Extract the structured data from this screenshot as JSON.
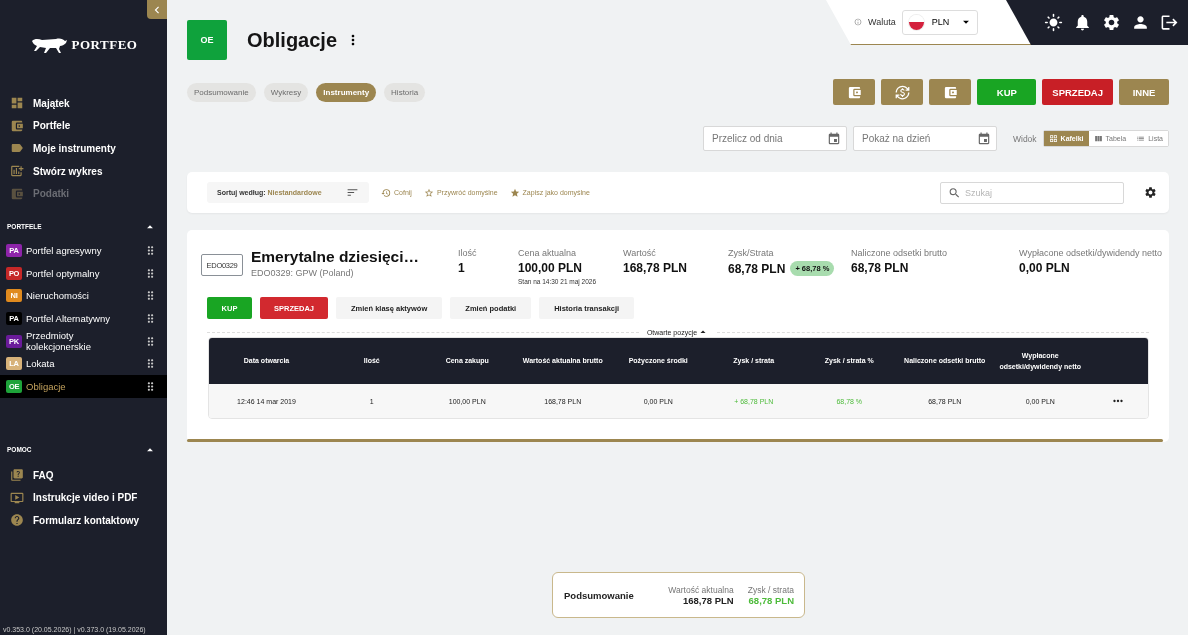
{
  "sidebar": {
    "logo": "PORTFEO",
    "nav": [
      {
        "label": "Majątek",
        "disabled": false
      },
      {
        "label": "Portfele",
        "disabled": false
      },
      {
        "label": "Moje instrumenty",
        "disabled": false
      },
      {
        "label": "Stwórz wykres",
        "disabled": false
      },
      {
        "label": "Podatki",
        "disabled": true
      }
    ],
    "portfolios": {
      "title": "PORTFELE",
      "expanded": true,
      "items": [
        {
          "badge": "PA",
          "label": "Portfel agresywny",
          "color": "#8e24aa",
          "selected": false
        },
        {
          "badge": "PO",
          "label": "Portfel optymalny",
          "color": "#c62828",
          "selected": false
        },
        {
          "badge": "NI",
          "label": "Nieruchomości",
          "color": "#e08a1e",
          "selected": false
        },
        {
          "badge": "PA",
          "label": "Portfel Alternatywny",
          "color": "#000000",
          "selected": false
        },
        {
          "badge": "PK",
          "label": "Przedmioty kolekcjonerskie",
          "color": "#6a1b9a",
          "selected": false
        },
        {
          "badge": "LA",
          "label": "Lokata",
          "color": "#d7b27a",
          "selected": false
        },
        {
          "badge": "OE",
          "label": "Obligacje",
          "color": "#1ea33a",
          "selected": true
        }
      ]
    },
    "help": {
      "title": "POMOC",
      "expanded": true,
      "items": [
        {
          "label": "FAQ"
        },
        {
          "label": "Instrukcje video i PDF"
        },
        {
          "label": "Formularz kontaktowy"
        }
      ]
    },
    "version": "v0.353.0 (20.05.2026) | v0.373.0 (19.05.2026)"
  },
  "header": {
    "currency_label": "Waluta",
    "currency": "PLN"
  },
  "page": {
    "badge": "OE",
    "title": "Obligacje",
    "tabs": [
      {
        "label": "Podsumowanie",
        "selected": false
      },
      {
        "label": "Wykresy",
        "selected": false
      },
      {
        "label": "Instrumenty",
        "selected": true
      },
      {
        "label": "Historia",
        "selected": false
      }
    ],
    "actions": [
      {
        "kind": "buy",
        "label": "KUP"
      },
      {
        "kind": "sell",
        "label": "SPRZEDAJ"
      },
      {
        "kind": "other",
        "label": "INNE"
      }
    ],
    "date_fields": [
      {
        "placeholder": "Przelicz od dnia"
      },
      {
        "placeholder": "Pokaż na dzień"
      }
    ],
    "view": {
      "label": "Widok",
      "options": [
        {
          "label": "Kafelki",
          "selected": true
        },
        {
          "label": "Tabela",
          "selected": false
        },
        {
          "label": "Lista",
          "selected": false
        }
      ]
    }
  },
  "toolbar": {
    "sort_label": "Sortuj według:",
    "sort_value": "Niestandardowe",
    "actions": [
      "Cofnij",
      "Przywróć domyślne",
      "Zapisz jako domyślne"
    ],
    "search_placeholder": "Szukaj"
  },
  "instrument": {
    "logo": "EDO0329",
    "name": "Emerytalne dziesięci…",
    "subtitle": "EDO0329: GPW (Poland)",
    "stats": [
      {
        "label": "Ilość",
        "value": "1"
      },
      {
        "label": "Cena aktualna",
        "value": "100,00 PLN",
        "note": "Stan na 14:30 21 maj 2026"
      },
      {
        "label": "Wartość",
        "value": "168,78 PLN"
      },
      {
        "label": "Zysk/Strata",
        "value": "68,78 PLN",
        "badge": "+ 68,78 %"
      },
      {
        "label": "Naliczone odsetki brutto",
        "value": "68,78 PLN"
      },
      {
        "label": "Wypłacone odsetki/dywidendy netto",
        "value": "0,00 PLN"
      }
    ],
    "actions": [
      {
        "kind": "buy",
        "label": "KUP"
      },
      {
        "kind": "sell",
        "label": "SPRZEDAJ"
      },
      {
        "kind": "plain",
        "label": "Zmień klasę aktywów"
      },
      {
        "kind": "plain",
        "label": "Zmień podatki"
      },
      {
        "kind": "plain",
        "label": "Historia transakcji"
      }
    ],
    "positions": {
      "title": "Otwarte pozycje",
      "expanded": true,
      "columns": [
        "Data otwarcia",
        "Ilość",
        "Cena zakupu",
        "Wartość aktualna brutto",
        "Pożyczone środki",
        "Zysk / strata",
        "Zysk / strata %",
        "Naliczone odsetki brutto",
        "Wypłacone odsetki/dywidendy netto"
      ],
      "rows": [
        {
          "cells": [
            {
              "text": "12:46 14 mar 2019",
              "positive": false
            },
            {
              "text": "1",
              "positive": false
            },
            {
              "text": "100,00 PLN",
              "positive": false
            },
            {
              "text": "168,78 PLN",
              "positive": false
            },
            {
              "text": "0,00 PLN",
              "positive": false
            },
            {
              "text": "+ 68,78 PLN",
              "positive": true
            },
            {
              "text": "68,78 %",
              "positive": true
            },
            {
              "text": "68,78 PLN",
              "positive": false
            },
            {
              "text": "0,00 PLN",
              "positive": false
            }
          ]
        }
      ]
    }
  },
  "summary": {
    "title": "Podsumowanie",
    "items": [
      {
        "label": "Wartość aktualna",
        "value": "168,78 PLN",
        "positive": false
      },
      {
        "label": "Zysk / strata",
        "value": "68,78 PLN",
        "positive": true
      }
    ]
  }
}
